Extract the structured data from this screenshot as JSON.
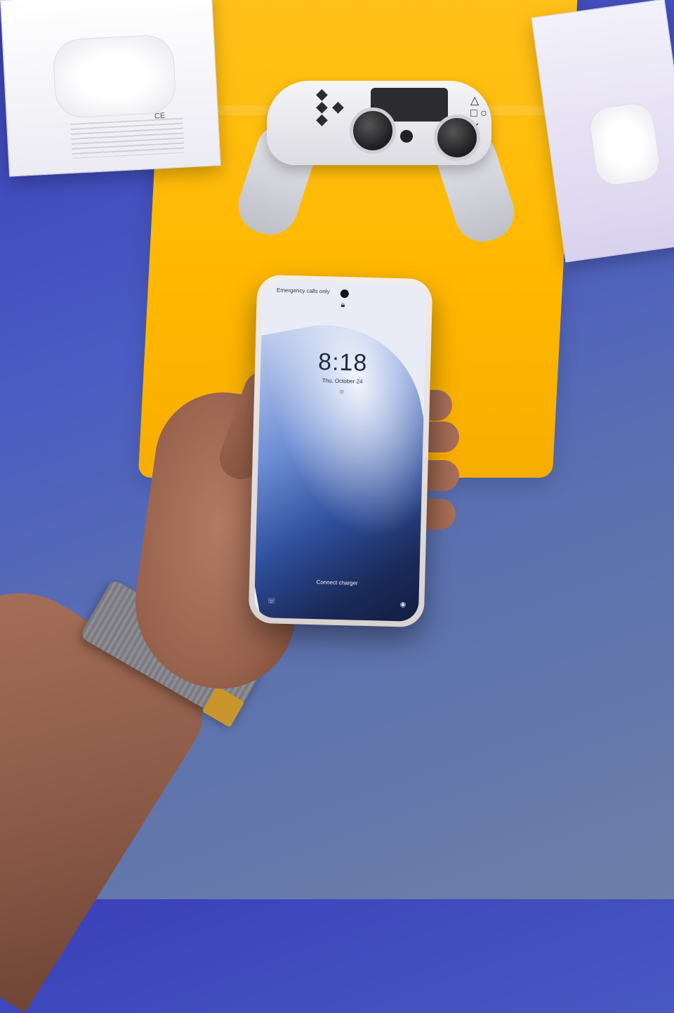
{
  "lockscreen": {
    "status_left": "Emergency calls only",
    "status_right": "",
    "time": "8:18",
    "date": "Thu, October 24",
    "charger_hint": "Connect charger"
  },
  "airpods_box": {
    "ce_mark": "CE"
  },
  "icons": {
    "lock": "lock-icon",
    "weather": "weather-icon",
    "phone": "phone-icon",
    "camera": "camera-icon"
  },
  "colors": {
    "board": "#ffb800",
    "background": "#4a5cc4",
    "strap_tab": "#c9962e"
  }
}
